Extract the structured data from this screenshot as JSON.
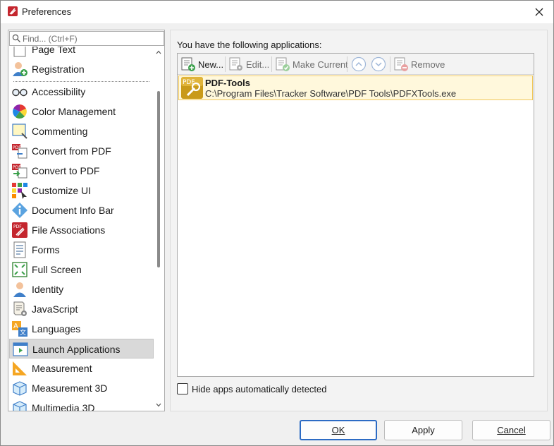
{
  "window": {
    "title": "Preferences"
  },
  "search": {
    "placeholder": "Find... (Ctrl+F)"
  },
  "sidebar": {
    "partial_item": "Page Text",
    "items_top": [
      {
        "label": "Registration",
        "icon": "registration-icon"
      }
    ],
    "items": [
      {
        "label": "Accessibility",
        "icon": "glasses-icon"
      },
      {
        "label": "Color Management",
        "icon": "color-wheel-icon"
      },
      {
        "label": "Commenting",
        "icon": "commenting-icon"
      },
      {
        "label": "Convert from PDF",
        "icon": "convert-from-pdf-icon"
      },
      {
        "label": "Convert to PDF",
        "icon": "convert-to-pdf-icon"
      },
      {
        "label": "Customize UI",
        "icon": "customize-ui-icon"
      },
      {
        "label": "Document Info Bar",
        "icon": "info-icon"
      },
      {
        "label": "File Associations",
        "icon": "file-associations-icon"
      },
      {
        "label": "Forms",
        "icon": "forms-icon"
      },
      {
        "label": "Full Screen",
        "icon": "full-screen-icon"
      },
      {
        "label": "Identity",
        "icon": "identity-icon"
      },
      {
        "label": "JavaScript",
        "icon": "javascript-icon"
      },
      {
        "label": "Languages",
        "icon": "languages-icon"
      },
      {
        "label": "Launch Applications",
        "icon": "launch-applications-icon",
        "selected": true
      },
      {
        "label": "Measurement",
        "icon": "measurement-icon"
      },
      {
        "label": "Measurement 3D",
        "icon": "measurement-3d-icon"
      },
      {
        "label": "Multimedia 3D",
        "icon": "multimedia-3d-icon"
      }
    ]
  },
  "main": {
    "heading": "You have the following applications:",
    "toolbar": {
      "new_label": "New...",
      "edit_label": "Edit...",
      "make_current_label": "Make Current",
      "remove_label": "Remove"
    },
    "applications": [
      {
        "name": "PDF-Tools",
        "path": "C:\\Program Files\\Tracker Software\\PDF Tools\\PDFXTools.exe",
        "icon_text": "PDF"
      }
    ],
    "hide_apps_label": "Hide apps automatically detected",
    "hide_apps_checked": false
  },
  "buttons": {
    "ok": "OK",
    "apply": "Apply",
    "cancel": "Cancel"
  },
  "colors": {
    "accent": "#2c6bc4",
    "selection_bg": "#d9d9d9",
    "app_row_bg": "#fff8dc",
    "app_row_border": "#f0c75a"
  }
}
